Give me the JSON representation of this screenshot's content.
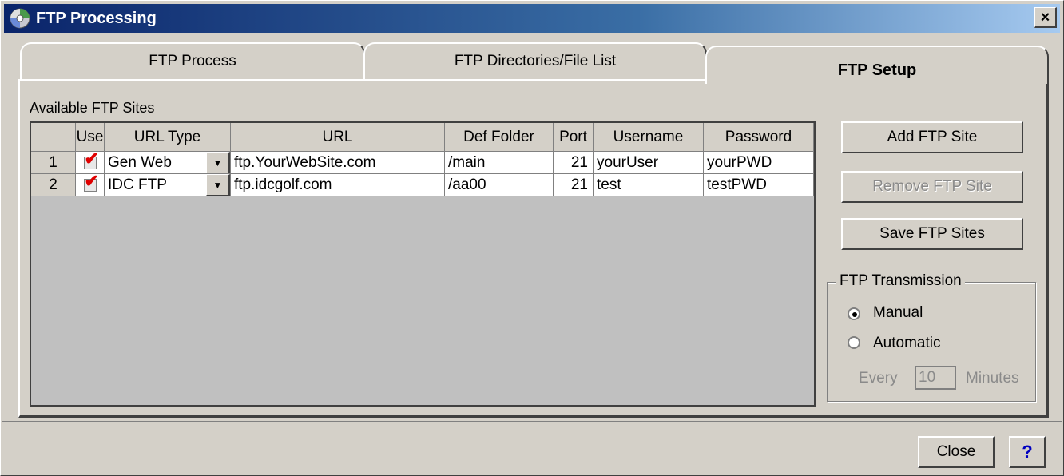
{
  "window": {
    "title": "FTP Processing",
    "close_glyph": "×"
  },
  "tabs": [
    {
      "label": "FTP Process"
    },
    {
      "label": "FTP Directories/File List"
    },
    {
      "label": "FTP Setup"
    }
  ],
  "grid": {
    "caption": "Available FTP Sites",
    "columns": [
      "Use",
      "URL Type",
      "URL",
      "Def Folder",
      "Port",
      "Username",
      "Password"
    ],
    "rows": [
      {
        "num": "1",
        "use": true,
        "url_type": "Gen Web",
        "url": "ftp.YourWebSite.com",
        "def_folder": "/main",
        "port": "21",
        "username": "yourUser",
        "password": "yourPWD"
      },
      {
        "num": "2",
        "use": true,
        "url_type": "IDC FTP",
        "url": "ftp.idcgolf.com",
        "def_folder": "/aa00",
        "port": "21",
        "username": "test",
        "password": "testPWD"
      }
    ]
  },
  "buttons": {
    "add": "Add FTP Site",
    "remove": "Remove FTP Site",
    "save": "Save FTP Sites",
    "close": "Close",
    "help": "?"
  },
  "transmission": {
    "legend": "FTP Transmission",
    "manual": "Manual",
    "automatic": "Automatic",
    "selected": "Manual",
    "every_label": "Every",
    "every_value": "10",
    "minutes_label": "Minutes"
  },
  "icons": {
    "title": "cd-disc-icon",
    "dropdown": "chevron-down-icon",
    "check": "checkmark-icon"
  },
  "colors": {
    "title_gradient_start": "#0a246a",
    "title_gradient_end": "#a6caf0",
    "check": "#e00000"
  }
}
